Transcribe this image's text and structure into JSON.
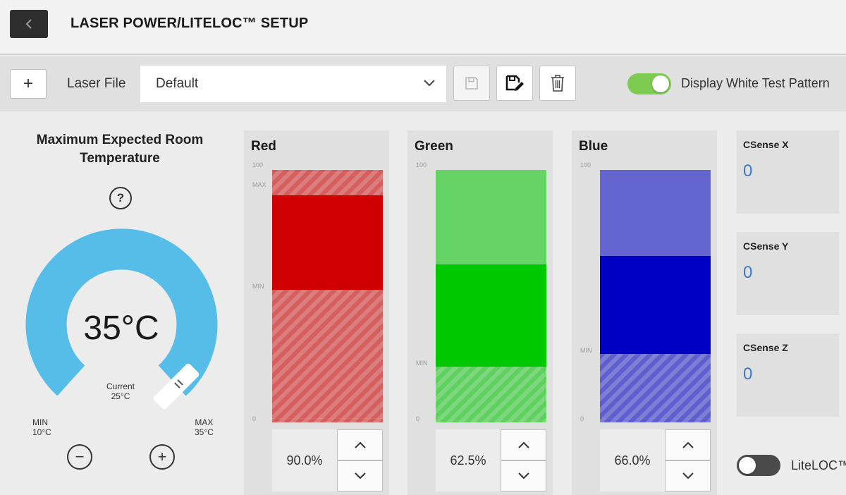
{
  "header": {
    "title": "LASER POWER/LITELOC™ SETUP"
  },
  "toolbar": {
    "add_label": "+",
    "laser_file_label": "Laser File",
    "laser_file_value": "Default",
    "white_test_pattern_label": "Display White Test Pattern",
    "white_test_pattern_on": true
  },
  "temperature": {
    "title": "Maximum Expected Room Temperature",
    "help_symbol": "?",
    "value": "35°C",
    "current_label": "Current",
    "current_value": "25°C",
    "min_label": "MIN",
    "min_value": "10°C",
    "max_label": "MAX",
    "max_value": "35°C",
    "minus_symbol": "−",
    "plus_symbol": "+",
    "gauge_color": "#56bde9"
  },
  "channels": [
    {
      "name": "Red",
      "value": "90.0%",
      "min_pct": 52.5,
      "max_pct": 90.0,
      "color": "#d10000",
      "scale_top": "100",
      "scale_max": "MAX",
      "scale_min": "MIN",
      "scale_zero": "0"
    },
    {
      "name": "Green",
      "value": "62.5%",
      "min_pct": 22.0,
      "max_pct": 62.5,
      "color": "#00c800",
      "scale_top": "100",
      "scale_min": "MIN",
      "scale_zero": "0"
    },
    {
      "name": "Blue",
      "value": "66.0%",
      "min_pct": 27.0,
      "max_pct": 66.0,
      "color": "#0000c4",
      "scale_top": "100",
      "scale_min": "MIN",
      "scale_zero": "0"
    }
  ],
  "csense": [
    {
      "label": "CSense X",
      "value": "0"
    },
    {
      "label": "CSense Y",
      "value": "0"
    },
    {
      "label": "CSense Z",
      "value": "0"
    }
  ],
  "liteloc": {
    "label": "LiteLOC™",
    "on": false
  }
}
